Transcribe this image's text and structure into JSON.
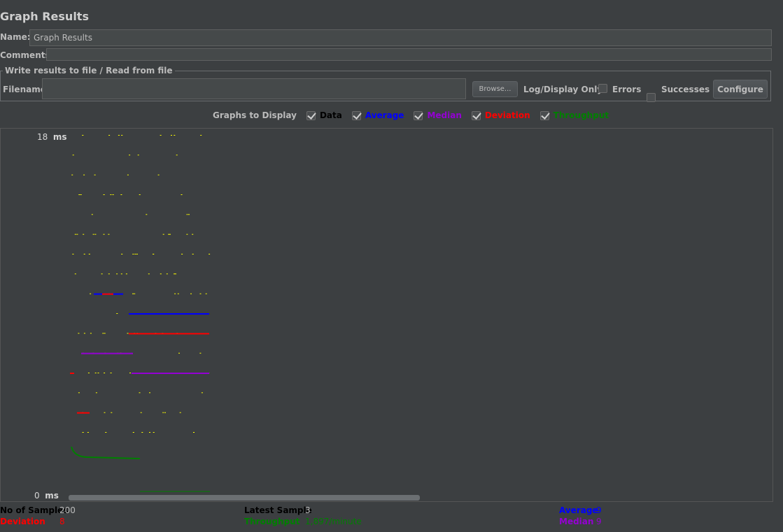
{
  "title": "Graph Results",
  "name_label": "Name:",
  "name_value": "Graph Results",
  "comments_label": "Comments:",
  "comments_value": "",
  "file_group": {
    "legend": "Write results to file / Read from file",
    "filename_label": "Filename",
    "filename_value": "",
    "browse_label": "Browse...",
    "log_display_label": "Log/Display Only:",
    "errors_label": "Errors",
    "successes_label": "Successes",
    "configure_label": "Configure"
  },
  "graphs": {
    "label": "Graphs to Display",
    "items": [
      {
        "label": "Data",
        "color": "#000000",
        "checked": true
      },
      {
        "label": "Average",
        "color": "#0000ff",
        "checked": true
      },
      {
        "label": "Median",
        "color": "#9400d3",
        "checked": true
      },
      {
        "label": "Deviation",
        "color": "#ff0000",
        "checked": true
      },
      {
        "label": "Throughput",
        "color": "#008000",
        "checked": true
      }
    ]
  },
  "axis": {
    "top": "18",
    "bottom": "0",
    "unit": "ms"
  },
  "stats": {
    "samples_label": "No of Samples",
    "samples_value": "200",
    "latest_label": "Latest Sample",
    "latest_value": "3",
    "average_label": "Average",
    "average_value": "9",
    "deviation_label": "Deviation",
    "deviation_value": "8",
    "throughput_label": "Throughput",
    "throughput_value": "1,897/minute",
    "median_label": "Median",
    "median_value": "9"
  },
  "chart_data": {
    "type": "scatter",
    "ylim": [
      0,
      18
    ],
    "ylabel": "ms",
    "samples": 200,
    "series": [
      {
        "name": "Data",
        "color": "#ffff00"
      },
      {
        "name": "Average",
        "color": "#0000ff",
        "final_value": 9
      },
      {
        "name": "Median",
        "color": "#9400d3",
        "final_value": 9
      },
      {
        "name": "Deviation",
        "color": "#ff0000",
        "final_value": 8
      },
      {
        "name": "Throughput",
        "color": "#008000",
        "final_value": "1,897/minute"
      }
    ]
  }
}
